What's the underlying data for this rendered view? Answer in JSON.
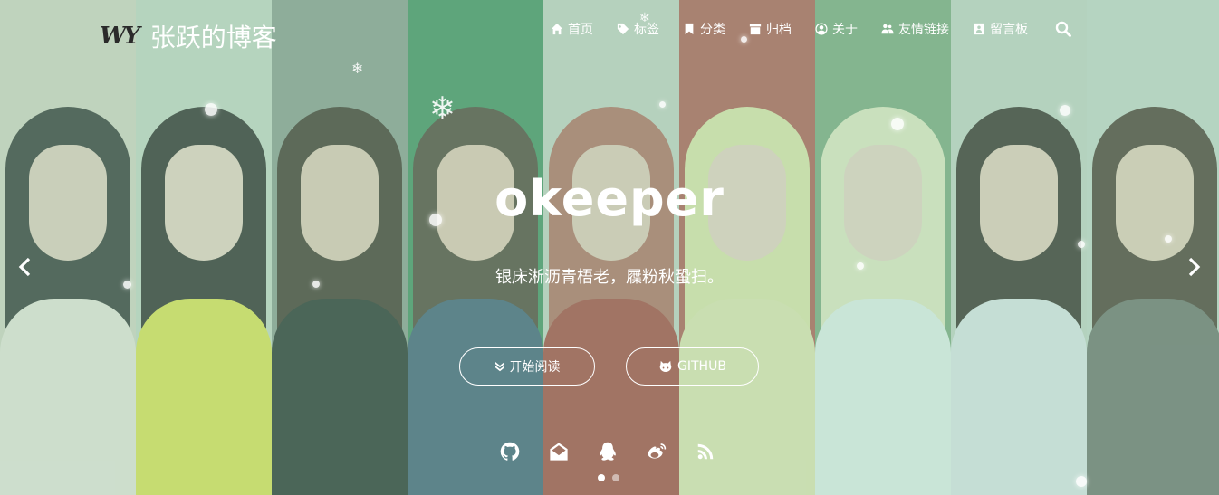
{
  "logo": {
    "mark": "WY",
    "text": "张跃的博客"
  },
  "nav": [
    {
      "label": "首页",
      "icon": "home-icon"
    },
    {
      "label": "标签",
      "icon": "tags-icon"
    },
    {
      "label": "分类",
      "icon": "bookmark-icon"
    },
    {
      "label": "归档",
      "icon": "archive-icon"
    },
    {
      "label": "关于",
      "icon": "user-circle-icon"
    },
    {
      "label": "友情链接",
      "icon": "users-icon"
    },
    {
      "label": "留言板",
      "icon": "guestbook-icon"
    }
  ],
  "hero": {
    "title": "okeeper",
    "subtitle": "银床淅沥青梧老，屧粉秋蛩扫。",
    "read_button": "开始阅读",
    "github_button": "GITHUB"
  },
  "social_icons": [
    "github-icon",
    "mail-icon",
    "qq-icon",
    "weibo-icon",
    "rss-icon"
  ],
  "carousel": {
    "slide_count": 2,
    "active_index": 0
  },
  "colors": {
    "overlay": "#96d2b4",
    "text": "#ffffff"
  }
}
